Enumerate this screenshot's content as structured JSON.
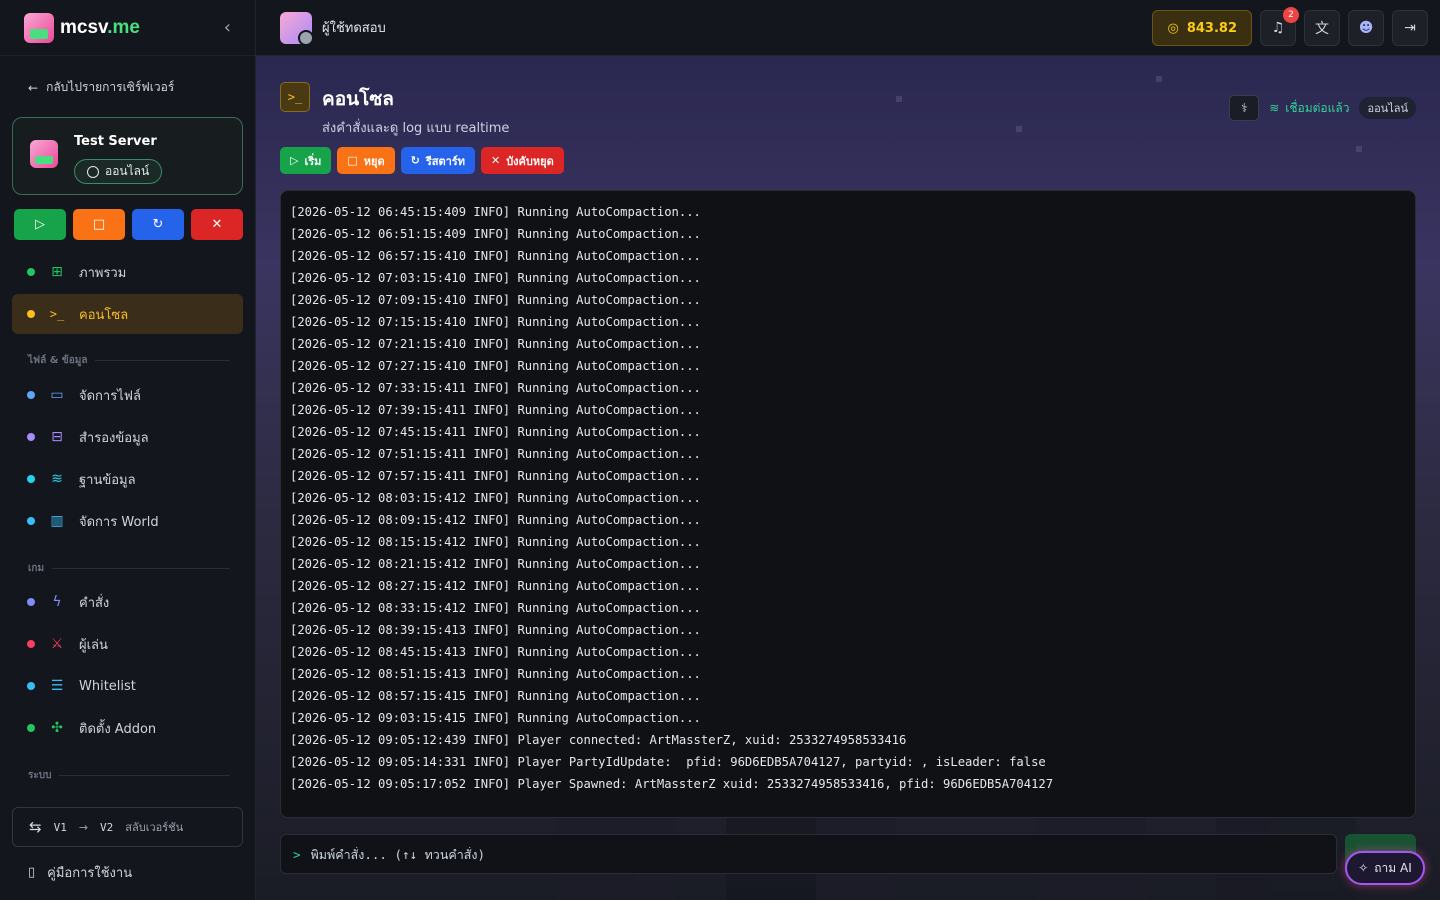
{
  "app": {
    "logo": {
      "name_main": "mcsv",
      "name_suffix": ".me"
    },
    "collapse_icon": "chevron-left-icon"
  },
  "sidebar": {
    "back_label": "กลับไปรายการเซิร์ฟเวอร์",
    "server": {
      "name": "Test Server",
      "status": "ออนไลน์"
    },
    "server_actions": [
      {
        "icon": "play-icon",
        "color": "#16a34a"
      },
      {
        "icon": "stop-icon",
        "color": "#f97316"
      },
      {
        "icon": "restart-icon",
        "color": "#2563eb"
      },
      {
        "icon": "kill-icon",
        "color": "#dc2626"
      }
    ],
    "nav_main": [
      {
        "label": "ภาพรวม",
        "icon": "grid-icon",
        "dot": "#22c55e"
      },
      {
        "label": "คอนโซล",
        "icon": "terminal-icon",
        "dot": "#fbbf24",
        "active": true
      }
    ],
    "section_files": "ไฟล์ & ข้อมูล",
    "nav_files": [
      {
        "label": "จัดการไฟล์",
        "icon": "folder-icon",
        "dot": "#60a5fa"
      },
      {
        "label": "สำรองข้อมูล",
        "icon": "archive-icon",
        "dot": "#a78bfa"
      },
      {
        "label": "ฐานข้อมูล",
        "icon": "database-icon",
        "dot": "#22d3ee"
      },
      {
        "label": "จัดการ World",
        "icon": "map-icon",
        "dot": "#38bdf8"
      }
    ],
    "section_game": "เกม",
    "nav_game": [
      {
        "label": "คำสั่ง",
        "icon": "lightning-icon",
        "dot": "#818cf8"
      },
      {
        "label": "ผู้เล่น",
        "icon": "swords-icon",
        "dot": "#f43f5e"
      },
      {
        "label": "Whitelist",
        "icon": "list-check-icon",
        "dot": "#38bdf8"
      },
      {
        "label": "ติดตั้ง Addon",
        "icon": "puzzle-icon",
        "dot": "#22c55e"
      }
    ],
    "section_system": "ระบบ",
    "switch": {
      "from": "V1",
      "arrow": "→",
      "to": "V2",
      "label": "สลับเวอร์ชัน"
    },
    "manual_label": "คู่มือการใช้งาน"
  },
  "topbar": {
    "user_name": "ผู้ใช้ทดสอบ",
    "coins": "843.82",
    "notification_count": "2"
  },
  "page": {
    "title": "คอนโซล",
    "subtitle": "ส่งคำสั่งและดู log แบบ realtime",
    "connection_text": "เชื่อมต่อแล้ว",
    "online_label": "ออนไลน์",
    "actions": {
      "start": "เริ่ม",
      "stop": "หยุด",
      "restart": "รีสตาร์ท",
      "kill": "บังคับหยุด"
    }
  },
  "console": {
    "lines": [
      "[2026-05-12 06:45:15:409 INFO] Running AutoCompaction...",
      "[2026-05-12 06:51:15:409 INFO] Running AutoCompaction...",
      "[2026-05-12 06:57:15:410 INFO] Running AutoCompaction...",
      "[2026-05-12 07:03:15:410 INFO] Running AutoCompaction...",
      "[2026-05-12 07:09:15:410 INFO] Running AutoCompaction...",
      "[2026-05-12 07:15:15:410 INFO] Running AutoCompaction...",
      "[2026-05-12 07:21:15:410 INFO] Running AutoCompaction...",
      "[2026-05-12 07:27:15:410 INFO] Running AutoCompaction...",
      "[2026-05-12 07:33:15:411 INFO] Running AutoCompaction...",
      "[2026-05-12 07:39:15:411 INFO] Running AutoCompaction...",
      "[2026-05-12 07:45:15:411 INFO] Running AutoCompaction...",
      "[2026-05-12 07:51:15:411 INFO] Running AutoCompaction...",
      "[2026-05-12 07:57:15:411 INFO] Running AutoCompaction...",
      "[2026-05-12 08:03:15:412 INFO] Running AutoCompaction...",
      "[2026-05-12 08:09:15:412 INFO] Running AutoCompaction...",
      "[2026-05-12 08:15:15:412 INFO] Running AutoCompaction...",
      "[2026-05-12 08:21:15:412 INFO] Running AutoCompaction...",
      "[2026-05-12 08:27:15:412 INFO] Running AutoCompaction...",
      "[2026-05-12 08:33:15:412 INFO] Running AutoCompaction...",
      "[2026-05-12 08:39:15:413 INFO] Running AutoCompaction...",
      "[2026-05-12 08:45:15:413 INFO] Running AutoCompaction...",
      "[2026-05-12 08:51:15:413 INFO] Running AutoCompaction...",
      "[2026-05-12 08:57:15:415 INFO] Running AutoCompaction...",
      "[2026-05-12 09:03:15:415 INFO] Running AutoCompaction...",
      "[2026-05-12 09:05:12:439 INFO] Player connected: ArtMassterZ, xuid: 2533274958533416",
      "[2026-05-12 09:05:14:331 INFO] Player PartyIdUpdate:  pfid: 96D6EDB5A704127, partyid: , isLeader: false",
      "[2026-05-12 09:05:17:052 INFO] Player Spawned: ArtMassterZ xuid: 2533274958533416, pfid: 96D6EDB5A704127"
    ]
  },
  "command": {
    "prompt": ">",
    "placeholder": "พิมพ์คำสั่ง... (↑↓ ทวนคำสั่ง)",
    "ai_label": "ถาม AI"
  }
}
